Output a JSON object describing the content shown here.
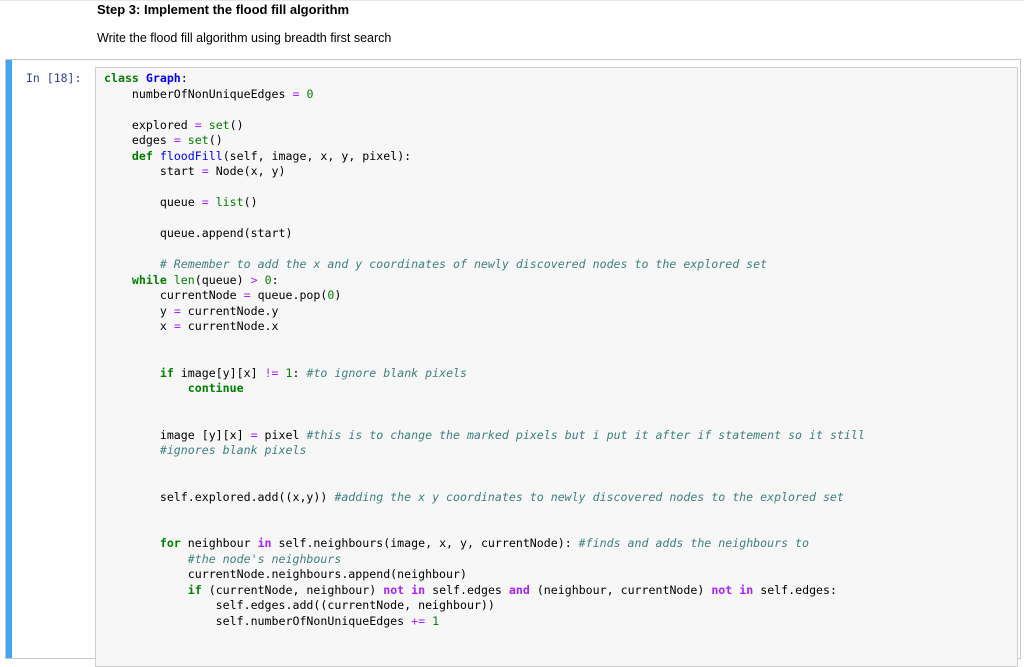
{
  "markdown": {
    "heading": "Step 3: Implement the flood fill algorithm",
    "paragraph": "Write the flood fill algorithm using breadth first search"
  },
  "cell": {
    "prompt": "In [18]:",
    "language": "python",
    "colors": {
      "keyword": "#008000",
      "builtin": "#008000",
      "function_name": "#0000ff",
      "number": "#008000",
      "operator": "#aa22ff",
      "comment": "#408080",
      "prompt": "#303f9f",
      "selected_bar": "#42a5f5",
      "input_bg": "#f7f7f7"
    },
    "lines": [
      [
        {
          "t": "class",
          "c": "kw"
        },
        {
          "t": " "
        },
        {
          "t": "Graph",
          "c": "cls"
        },
        {
          "t": ":"
        }
      ],
      [
        {
          "t": "    numberOfNonUniqueEdges "
        },
        {
          "t": "=",
          "c": "op"
        },
        {
          "t": " "
        },
        {
          "t": "0",
          "c": "num"
        }
      ],
      [],
      [
        {
          "t": "    explored "
        },
        {
          "t": "=",
          "c": "op"
        },
        {
          "t": " "
        },
        {
          "t": "set",
          "c": "bi"
        },
        {
          "t": "()"
        }
      ],
      [
        {
          "t": "    edges "
        },
        {
          "t": "=",
          "c": "op"
        },
        {
          "t": " "
        },
        {
          "t": "set",
          "c": "bi"
        },
        {
          "t": "()"
        }
      ],
      [
        {
          "t": "    "
        },
        {
          "t": "def",
          "c": "kw"
        },
        {
          "t": " "
        },
        {
          "t": "floodFill",
          "c": "fn"
        },
        {
          "t": "(self, image, x, y, pixel):"
        }
      ],
      [
        {
          "t": "        start "
        },
        {
          "t": "=",
          "c": "op"
        },
        {
          "t": " Node(x, y)"
        }
      ],
      [],
      [
        {
          "t": "        queue "
        },
        {
          "t": "=",
          "c": "op"
        },
        {
          "t": " "
        },
        {
          "t": "list",
          "c": "bi"
        },
        {
          "t": "()"
        }
      ],
      [],
      [
        {
          "t": "        queue.append(start)"
        }
      ],
      [],
      [
        {
          "t": "        "
        },
        {
          "t": "# Remember to add the x and y coordinates of newly discovered nodes to the explored set",
          "c": "cm"
        }
      ],
      [
        {
          "t": "    "
        },
        {
          "t": "while",
          "c": "kw"
        },
        {
          "t": " "
        },
        {
          "t": "len",
          "c": "bi"
        },
        {
          "t": "(queue) "
        },
        {
          "t": ">",
          "c": "op"
        },
        {
          "t": " "
        },
        {
          "t": "0",
          "c": "num"
        },
        {
          "t": ":"
        }
      ],
      [
        {
          "t": "        currentNode "
        },
        {
          "t": "=",
          "c": "op"
        },
        {
          "t": " queue.pop("
        },
        {
          "t": "0",
          "c": "num"
        },
        {
          "t": ")"
        }
      ],
      [
        {
          "t": "        y "
        },
        {
          "t": "=",
          "c": "op"
        },
        {
          "t": " currentNode.y"
        }
      ],
      [
        {
          "t": "        x "
        },
        {
          "t": "=",
          "c": "op"
        },
        {
          "t": " currentNode.x"
        }
      ],
      [],
      [],
      [
        {
          "t": "        "
        },
        {
          "t": "if",
          "c": "kw"
        },
        {
          "t": " image[y][x] "
        },
        {
          "t": "!=",
          "c": "op"
        },
        {
          "t": " "
        },
        {
          "t": "1",
          "c": "num"
        },
        {
          "t": ": "
        },
        {
          "t": "#to ignore blank pixels",
          "c": "cm"
        }
      ],
      [
        {
          "t": "            "
        },
        {
          "t": "continue",
          "c": "kw"
        }
      ],
      [],
      [],
      [
        {
          "t": "        image [y][x] "
        },
        {
          "t": "=",
          "c": "op"
        },
        {
          "t": " pixel "
        },
        {
          "t": "#this is to change the marked pixels but i put it after if statement so it still",
          "c": "cm"
        }
      ],
      [
        {
          "t": "        "
        },
        {
          "t": "#ignores blank pixels",
          "c": "cm"
        }
      ],
      [],
      [],
      [
        {
          "t": "        self.explored.add((x,y)) "
        },
        {
          "t": "#adding the x y coordinates to newly discovered nodes to the explored set",
          "c": "cm"
        }
      ],
      [],
      [],
      [
        {
          "t": "        "
        },
        {
          "t": "for",
          "c": "kw"
        },
        {
          "t": " neighbour "
        },
        {
          "t": "in",
          "c": "op-b"
        },
        {
          "t": " self.neighbours(image, x, y, currentNode): "
        },
        {
          "t": "#finds and adds the neighbours to",
          "c": "cm"
        }
      ],
      [
        {
          "t": "            "
        },
        {
          "t": "#the node's neighbours",
          "c": "cm"
        }
      ],
      [
        {
          "t": "            currentNode.neighbours.append(neighbour)"
        }
      ],
      [
        {
          "t": "            "
        },
        {
          "t": "if",
          "c": "kw"
        },
        {
          "t": " (currentNode, neighbour) "
        },
        {
          "t": "not",
          "c": "op-b"
        },
        {
          "t": " "
        },
        {
          "t": "in",
          "c": "op-b"
        },
        {
          "t": " self.edges "
        },
        {
          "t": "and",
          "c": "op-b"
        },
        {
          "t": " (neighbour, currentNode) "
        },
        {
          "t": "not",
          "c": "op-b"
        },
        {
          "t": " "
        },
        {
          "t": "in",
          "c": "op-b"
        },
        {
          "t": " self.edges:"
        }
      ],
      [
        {
          "t": "                self.edges.add((currentNode, neighbour))"
        }
      ],
      [
        {
          "t": "                self.numberOfNonUniqueEdges "
        },
        {
          "t": "+=",
          "c": "op"
        },
        {
          "t": " "
        },
        {
          "t": "1",
          "c": "num"
        }
      ]
    ]
  }
}
